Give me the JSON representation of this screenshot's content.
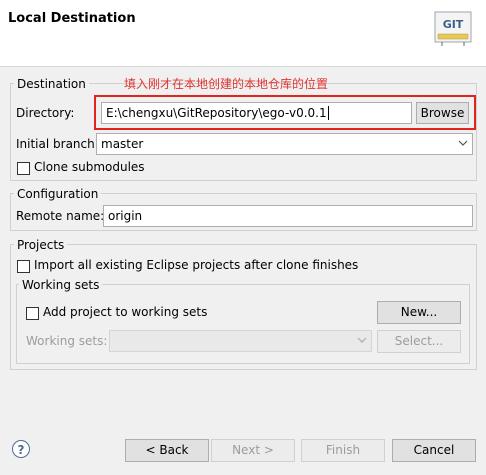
{
  "header": {
    "title": "Local Destination",
    "logo_text": "GIT"
  },
  "annotation": "填入刚才在本地创建的本地仓库的位置",
  "destination": {
    "legend": "Destination",
    "directory_label": "Directory:",
    "directory_value": "E:\\chengxu\\GitRepository\\ego-v0.0.1",
    "browse_label": "Browse",
    "initial_branch_label": "Initial branch:",
    "initial_branch_value": "master",
    "clone_submodules_label": "Clone submodules",
    "clone_submodules_checked": false
  },
  "configuration": {
    "legend": "Configuration",
    "remote_name_label": "Remote name:",
    "remote_name_value": "origin"
  },
  "projects": {
    "legend": "Projects",
    "import_label": "Import all existing Eclipse projects after clone finishes",
    "import_checked": false,
    "working_sets": {
      "legend": "Working sets",
      "add_label": "Add project to working sets",
      "add_checked": false,
      "new_label": "New...",
      "working_sets_label": "Working sets:",
      "working_sets_value": "",
      "select_label": "Select..."
    }
  },
  "footer": {
    "help_icon": "?",
    "back_label": "< Back",
    "next_label": "Next >",
    "finish_label": "Finish",
    "cancel_label": "Cancel"
  }
}
